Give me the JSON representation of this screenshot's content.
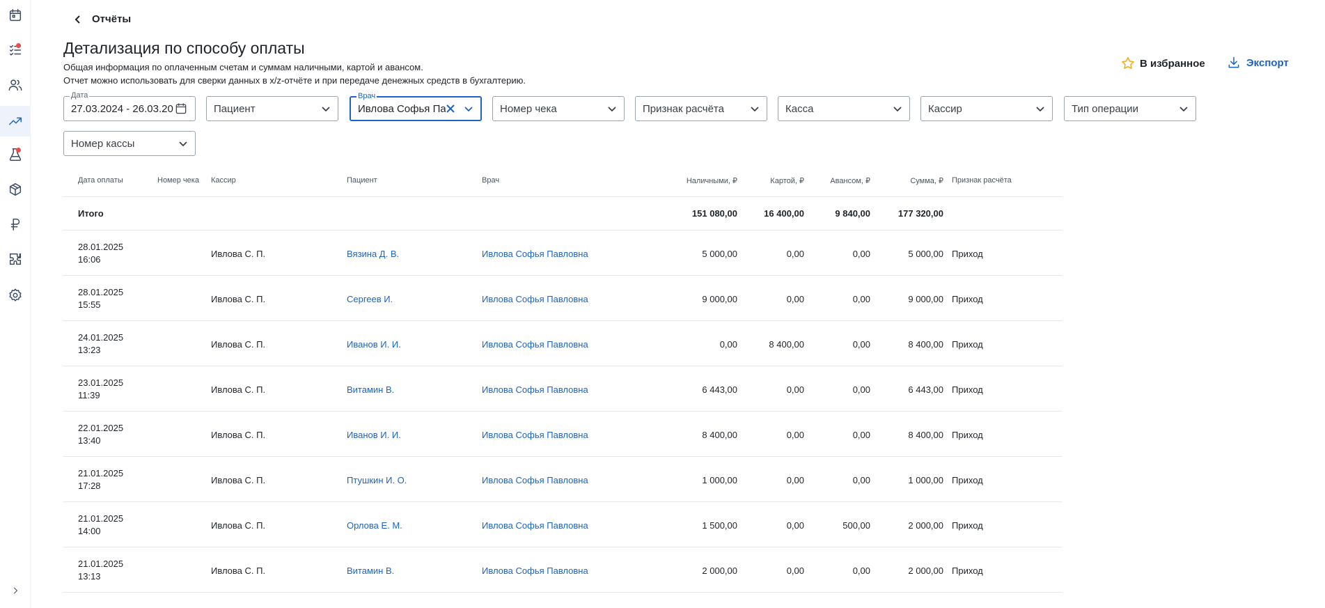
{
  "header": {
    "back_label": "Отчёты",
    "title": "Детализация по способу оплаты",
    "description_line1": "Общая информация по оплаченным счетам и суммам наличными, картой и авансом.",
    "description_line2": "Отчет можно использовать для сверки данных в x/z-отчёте и при передаче денежных средств в бухгалтерию.",
    "favorite_label": "В избранное",
    "export_label": "Экспорт"
  },
  "filters": {
    "date": {
      "label": "Дата",
      "value": "27.03.2024 - 26.03.20"
    },
    "patient": "Пациент",
    "doctor": {
      "label": "Врач",
      "value": "Ивлова Софья Павловна"
    },
    "check_number": "Номер чека",
    "payment_sign": "Признак расчёта",
    "cash_desk": "Касса",
    "cashier": "Кассир",
    "operation_type": "Тип операции",
    "cash_desk_number": "Номер кассы"
  },
  "table": {
    "columns": {
      "date": "Дата оплаты",
      "check": "Номер чека",
      "cashier": "Кассир",
      "patient": "Пациент",
      "doctor": "Врач",
      "cash": "Наличными, ₽",
      "card": "Картой, ₽",
      "advance": "Авансом, ₽",
      "sum": "Сумма, ₽",
      "sign": "Признак расчёта"
    },
    "total": {
      "label": "Итого",
      "cash": "151 080,00",
      "card": "16 400,00",
      "advance": "9 840,00",
      "sum": "177 320,00"
    },
    "rows": [
      {
        "date": "28.01.2025\n16:06",
        "check": "",
        "cashier": "Ивлова С. П.",
        "patient": "Вязина Д. В.",
        "doctor": "Ивлова Софья Павловна",
        "cash": "5 000,00",
        "card": "0,00",
        "advance": "0,00",
        "sum": "5 000,00",
        "sign": "Приход"
      },
      {
        "date": "28.01.2025\n15:55",
        "check": "",
        "cashier": "Ивлова С. П.",
        "patient": "Сергеев И.",
        "doctor": "Ивлова Софья Павловна",
        "cash": "9 000,00",
        "card": "0,00",
        "advance": "0,00",
        "sum": "9 000,00",
        "sign": "Приход"
      },
      {
        "date": "24.01.2025\n13:23",
        "check": "",
        "cashier": "Ивлова С. П.",
        "patient": "Иванов И. И.",
        "doctor": "Ивлова Софья Павловна",
        "cash": "0,00",
        "card": "8 400,00",
        "advance": "0,00",
        "sum": "8 400,00",
        "sign": "Приход"
      },
      {
        "date": "23.01.2025\n11:39",
        "check": "",
        "cashier": "Ивлова С. П.",
        "patient": "Витамин В.",
        "doctor": "Ивлова Софья Павловна",
        "cash": "6 443,00",
        "card": "0,00",
        "advance": "0,00",
        "sum": "6 443,00",
        "sign": "Приход"
      },
      {
        "date": "22.01.2025\n13:40",
        "check": "",
        "cashier": "Ивлова С. П.",
        "patient": "Иванов И. И.",
        "doctor": "Ивлова Софья Павловна",
        "cash": "8 400,00",
        "card": "0,00",
        "advance": "0,00",
        "sum": "8 400,00",
        "sign": "Приход"
      },
      {
        "date": "21.01.2025\n17:28",
        "check": "",
        "cashier": "Ивлова С. П.",
        "patient": "Птушкин И. О.",
        "doctor": "Ивлова Софья Павловна",
        "cash": "1 000,00",
        "card": "0,00",
        "advance": "0,00",
        "sum": "1 000,00",
        "sign": "Приход"
      },
      {
        "date": "21.01.2025\n14:00",
        "check": "",
        "cashier": "Ивлова С. П.",
        "patient": "Орлова Е. М.",
        "doctor": "Ивлова Софья Павловна",
        "cash": "1 500,00",
        "card": "0,00",
        "advance": "500,00",
        "sum": "2 000,00",
        "sign": "Приход"
      },
      {
        "date": "21.01.2025\n13:13",
        "check": "",
        "cashier": "Ивлова С. П.",
        "patient": "Витамин В.",
        "doctor": "Ивлова Софья Павловна",
        "cash": "2 000,00",
        "card": "0,00",
        "advance": "0,00",
        "sum": "2 000,00",
        "sign": "Приход"
      }
    ]
  },
  "sidebar": {
    "icons": [
      "calendar-icon",
      "tasks-icon",
      "patients-icon",
      "reports-icon",
      "lab-icon",
      "warehouse-icon",
      "finance-icon",
      "integrations-icon",
      "settings-icon"
    ],
    "notification_color": "#f04a4a"
  },
  "colors": {
    "accent": "#1c63c9",
    "favorite": "#f2a516"
  }
}
